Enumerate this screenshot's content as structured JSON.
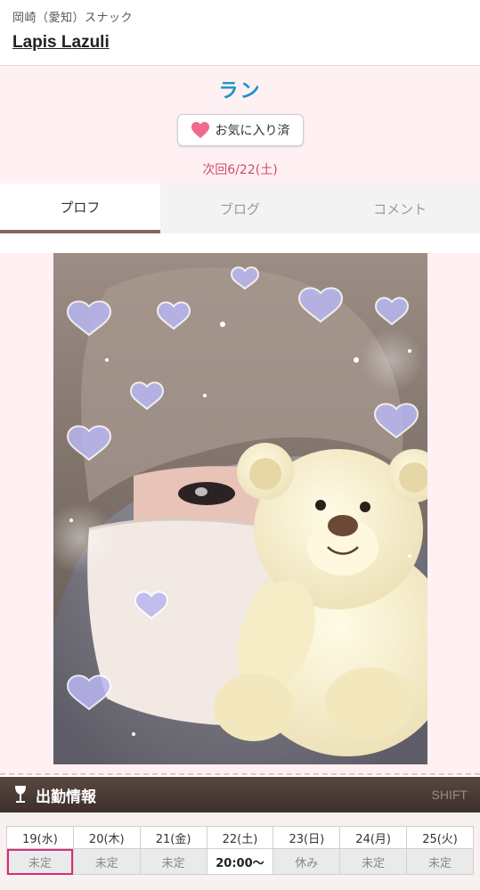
{
  "header": {
    "area": "岡崎（愛知）スナック",
    "shop_name": "Lapis Lazuli"
  },
  "profile": {
    "name": "ラン",
    "favorite_label": "お気に入り済",
    "next_date": "次回6/22(土)"
  },
  "tabs": [
    {
      "label": "プロフ",
      "active": true
    },
    {
      "label": "ブログ",
      "active": false
    },
    {
      "label": "コメント",
      "active": false
    }
  ],
  "schedule": {
    "title": "出勤情報",
    "shift_label": "SHIFT",
    "days": [
      {
        "day": "19(水)",
        "value": "未定"
      },
      {
        "day": "20(木)",
        "value": "未定"
      },
      {
        "day": "21(金)",
        "value": "未定"
      },
      {
        "day": "22(土)",
        "value": "20:00〜"
      },
      {
        "day": "23(日)",
        "value": "休み"
      },
      {
        "day": "24(月)",
        "value": "未定"
      },
      {
        "day": "25(火)",
        "value": "未定"
      }
    ]
  },
  "colors": {
    "accent_name": "#1c92c4",
    "next_date": "#d44a6e",
    "saturday": "#1aa6d3",
    "sunday": "#e05a9b",
    "heart": "#f06a8c",
    "schedule_bar": "#4a3a35"
  },
  "icons": {
    "favorite": "heart-icon",
    "schedule": "wine-glass-icon"
  }
}
